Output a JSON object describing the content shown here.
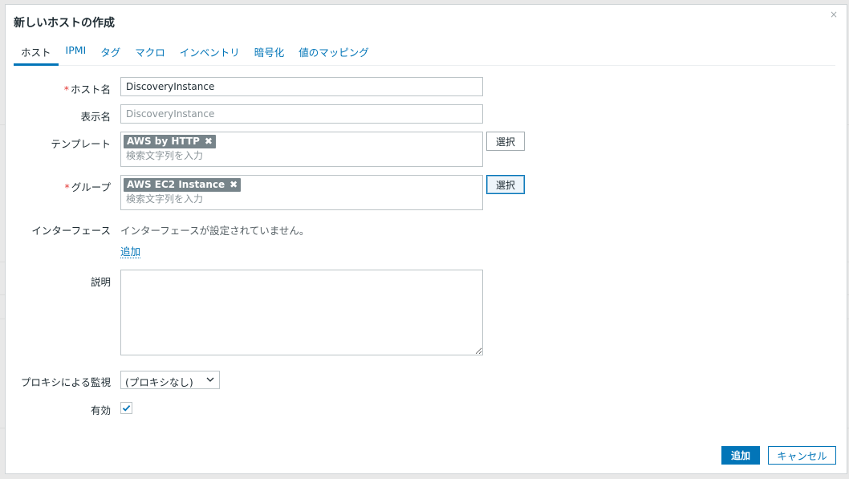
{
  "dialog": {
    "title": "新しいホストの作成",
    "close_icon": "×"
  },
  "tabs": [
    {
      "label": "ホスト",
      "active": true
    },
    {
      "label": "IPMI"
    },
    {
      "label": "タグ"
    },
    {
      "label": "マクロ"
    },
    {
      "label": "インベントリ"
    },
    {
      "label": "暗号化"
    },
    {
      "label": "値のマッピング"
    }
  ],
  "form": {
    "required_mark": "*",
    "host_name": {
      "label": "ホスト名",
      "value": "DiscoveryInstance"
    },
    "visible_name": {
      "label": "表示名",
      "placeholder": "DiscoveryInstance"
    },
    "templates": {
      "label": "テンプレート",
      "chips": [
        "AWS by HTTP"
      ],
      "placeholder": "検索文字列を入力",
      "select_label": "選択"
    },
    "groups": {
      "label": "グループ",
      "chips": [
        "AWS EC2 Instance"
      ],
      "placeholder": "検索文字列を入力",
      "select_label": "選択"
    },
    "interfaces": {
      "label": "インターフェース",
      "empty_text": "インターフェースが設定されていません。",
      "add_link": "追加"
    },
    "description": {
      "label": "説明",
      "value": ""
    },
    "proxy": {
      "label": "プロキシによる監視",
      "selected": "(プロキシなし)"
    },
    "enabled": {
      "label": "有効",
      "checked": true
    }
  },
  "footer": {
    "add_label": "追加",
    "cancel_label": "キャンセル"
  },
  "colors": {
    "accent": "#0275b8",
    "chip_bg": "#77848a",
    "required": "#e33734"
  },
  "icons": {
    "chip_remove": "remove-x-icon",
    "select_arrow": "chevron-down-icon",
    "check": "checkmark-icon"
  }
}
